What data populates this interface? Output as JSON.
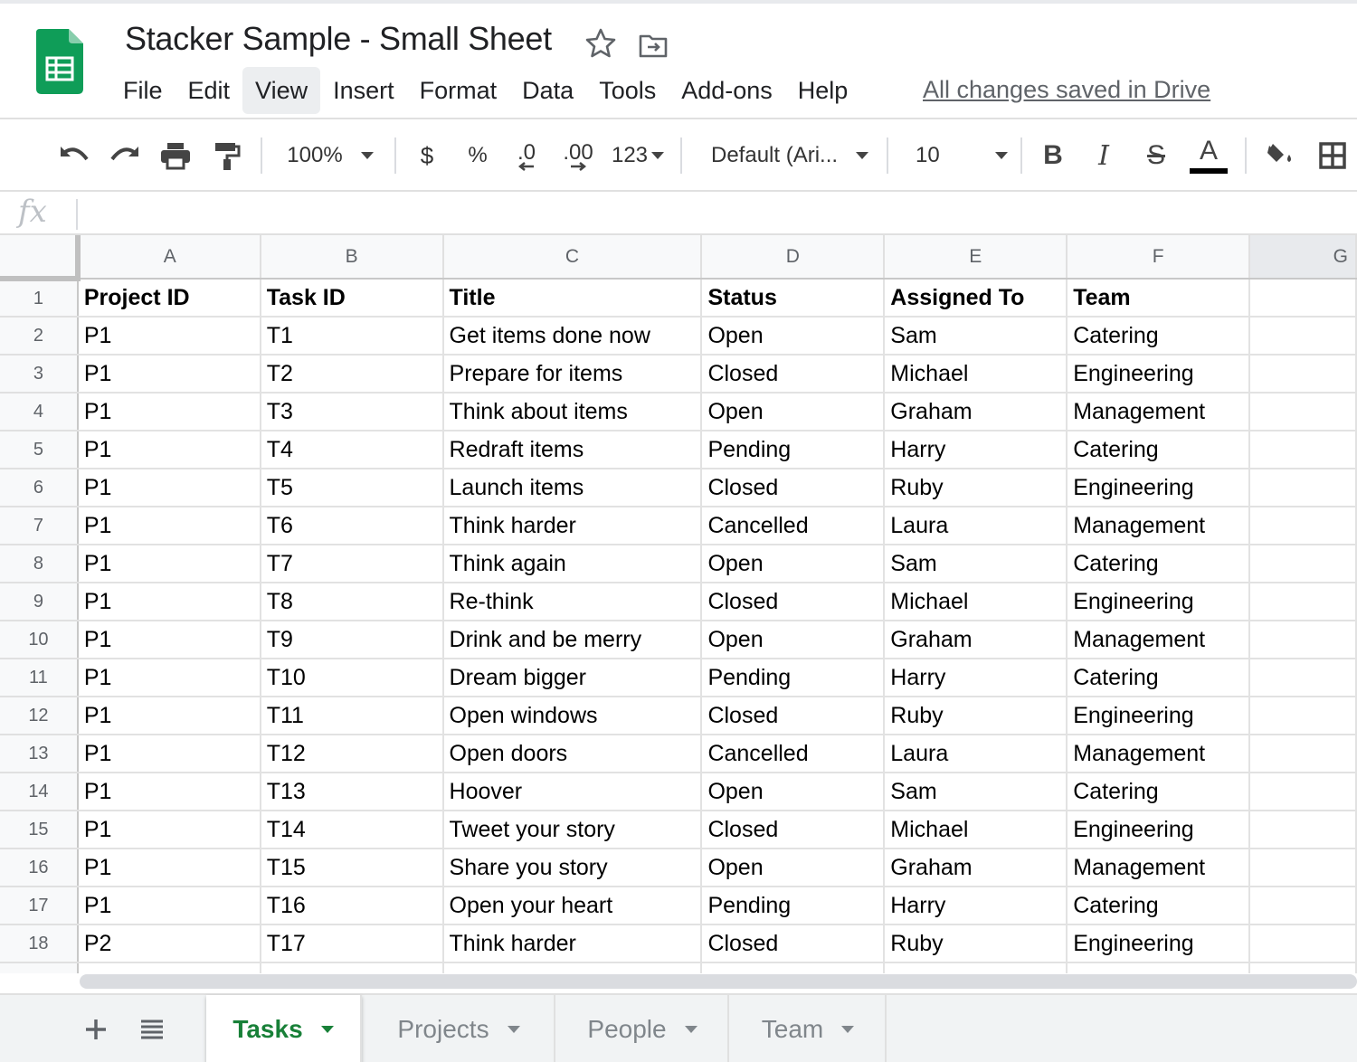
{
  "document": {
    "title": "Stacker Sample - Small Sheet",
    "save_status": "All changes saved in Drive"
  },
  "menu": [
    "File",
    "Edit",
    "View",
    "Insert",
    "Format",
    "Data",
    "Tools",
    "Add-ons",
    "Help"
  ],
  "active_menu": "View",
  "toolbar": {
    "zoom": "100%",
    "currency": "$",
    "percent": "%",
    "decrease_decimal": ".0",
    "increase_decimal": ".00",
    "number_format": "123",
    "font": "Default (Ari...",
    "font_size": "10",
    "bold": "B",
    "italic": "I",
    "strike": "S",
    "text_color_glyph": "A",
    "text_color": "#000000"
  },
  "formula_bar": {
    "label": "fx",
    "value": ""
  },
  "columns": [
    "A",
    "B",
    "C",
    "D",
    "E",
    "F",
    "G"
  ],
  "rows": [
    [
      "Project ID",
      "Task ID",
      "Title",
      "Status",
      "Assigned To",
      "Team"
    ],
    [
      "P1",
      "T1",
      "Get items done now",
      "Open",
      "Sam",
      "Catering"
    ],
    [
      "P1",
      "T2",
      "Prepare for items",
      "Closed",
      "Michael",
      "Engineering"
    ],
    [
      "P1",
      "T3",
      "Think about items",
      "Open",
      "Graham",
      "Management"
    ],
    [
      "P1",
      "T4",
      "Redraft items",
      "Pending",
      "Harry",
      "Catering"
    ],
    [
      "P1",
      "T5",
      "Launch items",
      "Closed",
      "Ruby",
      "Engineering"
    ],
    [
      "P1",
      "T6",
      "Think harder",
      "Cancelled",
      "Laura",
      "Management"
    ],
    [
      "P1",
      "T7",
      "Think again",
      "Open",
      "Sam",
      "Catering"
    ],
    [
      "P1",
      "T8",
      "Re-think",
      "Closed",
      "Michael",
      "Engineering"
    ],
    [
      "P1",
      "T9",
      "Drink and be merry",
      "Open",
      "Graham",
      "Management"
    ],
    [
      "P1",
      "T10",
      "Dream bigger",
      "Pending",
      "Harry",
      "Catering"
    ],
    [
      "P1",
      "T11",
      "Open windows",
      "Closed",
      "Ruby",
      "Engineering"
    ],
    [
      "P1",
      "T12",
      "Open doors",
      "Cancelled",
      "Laura",
      "Management"
    ],
    [
      "P1",
      "T13",
      "Hoover",
      "Open",
      "Sam",
      "Catering"
    ],
    [
      "P1",
      "T14",
      "Tweet your story",
      "Closed",
      "Michael",
      "Engineering"
    ],
    [
      "P1",
      "T15",
      "Share you story",
      "Open",
      "Graham",
      "Management"
    ],
    [
      "P1",
      "T16",
      "Open your heart",
      "Pending",
      "Harry",
      "Catering"
    ],
    [
      "P2",
      "T17",
      "Think harder",
      "Closed",
      "Ruby",
      "Engineering"
    ]
  ],
  "sheets": [
    "Tasks",
    "Projects",
    "People",
    "Team"
  ],
  "active_sheet": "Tasks",
  "colors": {
    "sheets_green": "#188038",
    "logo_green": "#0f9d58"
  }
}
